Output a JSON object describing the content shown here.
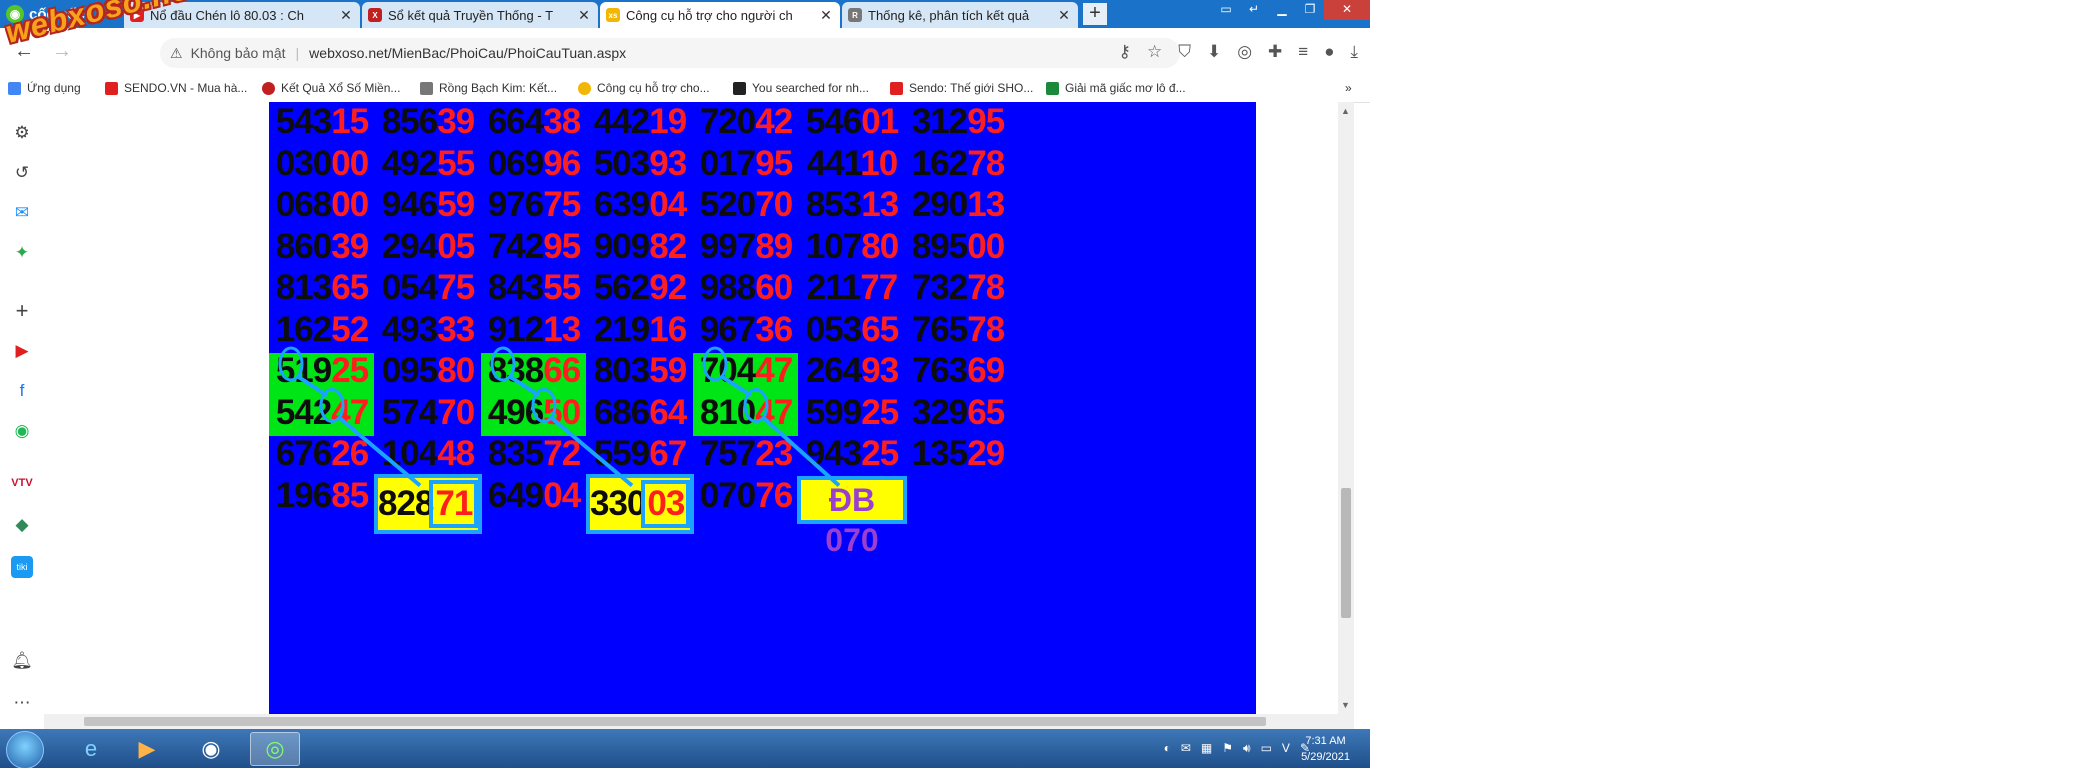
{
  "browser": {
    "brand": "cốc cốc",
    "tabs": [
      {
        "title": "Nổ đầu Chén lô 80.03 : Ch",
        "favicon": "youtube-icon",
        "active": false
      },
      {
        "title": "Sổ kết quả Truyền Thống - T",
        "favicon": "xskt-icon",
        "active": false
      },
      {
        "title": "Công cụ hỗ trợ cho người ch",
        "favicon": "xs-icon",
        "active": true
      },
      {
        "title": "Thống kê, phân tích kết quả",
        "favicon": "rbk-icon",
        "active": false
      }
    ],
    "new_tab": "+",
    "address": {
      "security": "Không bảo mật",
      "url": "webxoso.net/MienBac/PhoiCau/PhoiCauTuan.aspx"
    },
    "bookmarks": [
      {
        "label": "Ứng dụng",
        "color": "#4285f4"
      },
      {
        "label": "SENDO.VN - Mua hà...",
        "color": "#e02020"
      },
      {
        "label": "Kết Quả Xổ Số Miền...",
        "color": "#c02020"
      },
      {
        "label": "Rồng Bạch Kim: Kết...",
        "color": "#777777"
      },
      {
        "label": "Công cụ hỗ trợ cho...",
        "color": "#f2b705"
      },
      {
        "label": "You searched for nh...",
        "color": "#222222"
      },
      {
        "label": "Sendo: Thế giới SHO...",
        "color": "#e02020"
      },
      {
        "label": "Giải mã giấc mơ lô đ...",
        "color": "#1a8a3a"
      }
    ],
    "bookmarks_more": "»"
  },
  "watermark": "webxoso.net",
  "board": {
    "rows": [
      [
        "54315",
        "85639",
        "66438",
        "44219",
        "72042",
        "54601",
        "31295"
      ],
      [
        "03000",
        "49255",
        "06996",
        "50393",
        "01795",
        "44110",
        "16278"
      ],
      [
        "06800",
        "94659",
        "97675",
        "63904",
        "52070",
        "85313",
        "29013"
      ],
      [
        "86039",
        "29405",
        "74295",
        "90982",
        "99789",
        "10780",
        "89500"
      ],
      [
        "81365",
        "05475",
        "84355",
        "56292",
        "98860",
        "21177",
        "73278"
      ],
      [
        "16252",
        "49333",
        "91213",
        "21916",
        "96736",
        "05365",
        "76578"
      ],
      [
        "51925",
        "09580",
        "83866",
        "80359",
        "70447",
        "26493",
        "76369"
      ],
      [
        "54247",
        "57470",
        "49650",
        "68664",
        "81047",
        "59925",
        "32965"
      ],
      [
        "67626",
        "10448",
        "83572",
        "55967",
        "75723",
        "94325",
        "13529"
      ],
      [
        "19685",
        "82871",
        "64904",
        "33003",
        "07076",
        "",
        ""
      ]
    ],
    "special_label": "ĐB 070",
    "green_highlights": [
      [
        6,
        0
      ],
      [
        7,
        0
      ],
      [
        6,
        2
      ],
      [
        7,
        2
      ],
      [
        6,
        4
      ],
      [
        7,
        4
      ]
    ],
    "yellow_boxes": [
      [
        9,
        1
      ],
      [
        9,
        3
      ]
    ],
    "colors": {
      "background": "#0000ff",
      "head": "#0d0d0d",
      "tail": "#ff1e1e",
      "green": "#00e515",
      "yellow": "#ffff00",
      "line": "#1aa4ff",
      "special": "#9b3fcf"
    }
  },
  "taskbar": {
    "apps": [
      "ie-icon",
      "media-player-icon",
      "chrome-icon",
      "coccoc-icon"
    ],
    "time": "7:31 AM",
    "date": "5/29/2021"
  }
}
